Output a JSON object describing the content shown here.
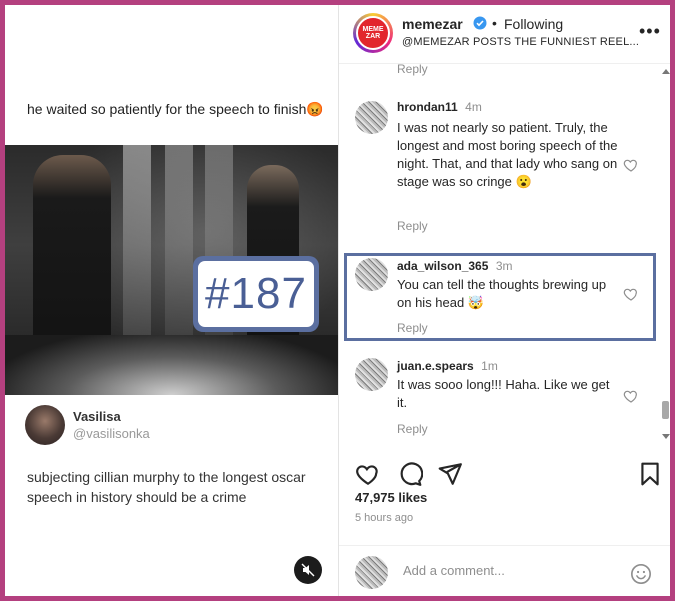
{
  "media": {
    "caption_top": "he waited so patiently for the speech to finish😡",
    "badge": "#187",
    "author_name": "Vasilisa",
    "author_handle": "@vasilisonka",
    "caption_bottom": "subjecting cillian murphy to the longest oscar speech in history should be a crime"
  },
  "header": {
    "logo_text": "MEME ZAR",
    "account": "memezar",
    "separator": "•",
    "following": "Following",
    "bio": "@MEMEZAR POSTS THE FUNNIEST REEL..."
  },
  "comments": {
    "reply_top": "Reply",
    "items": [
      {
        "user": "hrondan11",
        "time": "4m",
        "text": "I was not nearly so patient. Truly, the longest and most boring speech of the night. That, and that lady who sang on stage was so cringe 😮",
        "reply": "Reply"
      },
      {
        "user": "ada_wilson_365",
        "time": "3m",
        "text": "You can tell the thoughts brewing up on his head 🤯",
        "reply": "Reply"
      },
      {
        "user": "juan.e.spears",
        "time": "1m",
        "text": "It was sooo long!!! Haha. Like we get it.",
        "reply": "Reply"
      }
    ]
  },
  "footer": {
    "likes": "47,975 likes",
    "ago": "5 hours ago",
    "add_placeholder": "Add a comment..."
  },
  "colors": {
    "border": "#b4407f",
    "highlight": "#5b6fa0",
    "brand_red": "#e2262d",
    "verified_blue": "#3897f0"
  }
}
